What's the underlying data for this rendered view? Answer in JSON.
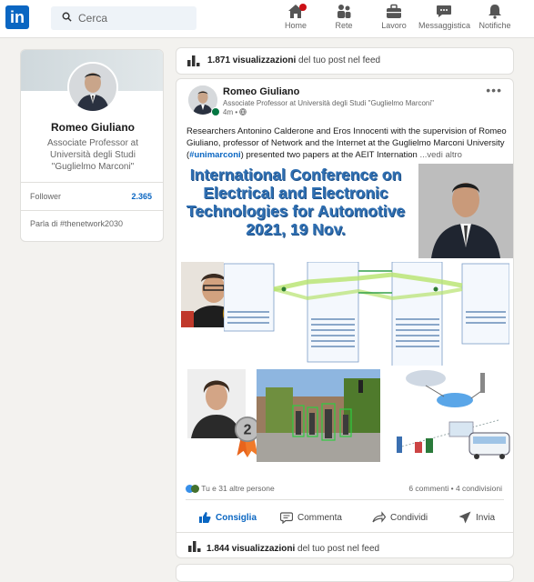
{
  "search": {
    "placeholder": "Cerca"
  },
  "nav": [
    {
      "label": "Home"
    },
    {
      "label": "Rete"
    },
    {
      "label": "Lavoro"
    },
    {
      "label": "Messaggistica"
    },
    {
      "label": "Notifiche"
    }
  ],
  "profile": {
    "name": "Romeo Giuliano",
    "headline": "Associate Professor at Università degli Studi \"Guglielmo Marconi\"",
    "follower_label": "Follower",
    "follower_count": "2.365",
    "hashtag": "Parla di #thenetwork2030"
  },
  "top_views": {
    "count": "1.871 visualizzazioni",
    "suffix": " del tuo post nel feed"
  },
  "post": {
    "author": "Romeo Giuliano",
    "subtitle": "Associate Professor at Università degli Studi \"Guglielmo Marconi\"",
    "time": "4m •",
    "text_1": "Researchers Antonino Calderone and Eros Innocenti with the supervision of Romeo Giuliano, professor of Network and the Internet at the Guglielmo Marconi University (",
    "hashtag": "#unimarconi",
    "text_2": ") presented two papers at the AEIT Internation",
    "more": "  ...vedi altro",
    "image_title": "International Conference on Electrical and Electronic Technologies for Automotive 2021, 19 Nov.",
    "reactions": "Tu e 31 altre persone",
    "comments": "6 commenti • 4 condivisioni",
    "actions": {
      "like": "Consiglia",
      "comment": "Commenta",
      "share": "Condividi",
      "send": "Invia"
    },
    "views_count": "1.844 visualizzazioni",
    "views_suffix": " del tuo post nel feed"
  },
  "colors": {
    "brand": "#0a66c2",
    "title_blue": "#2f6fb2"
  }
}
